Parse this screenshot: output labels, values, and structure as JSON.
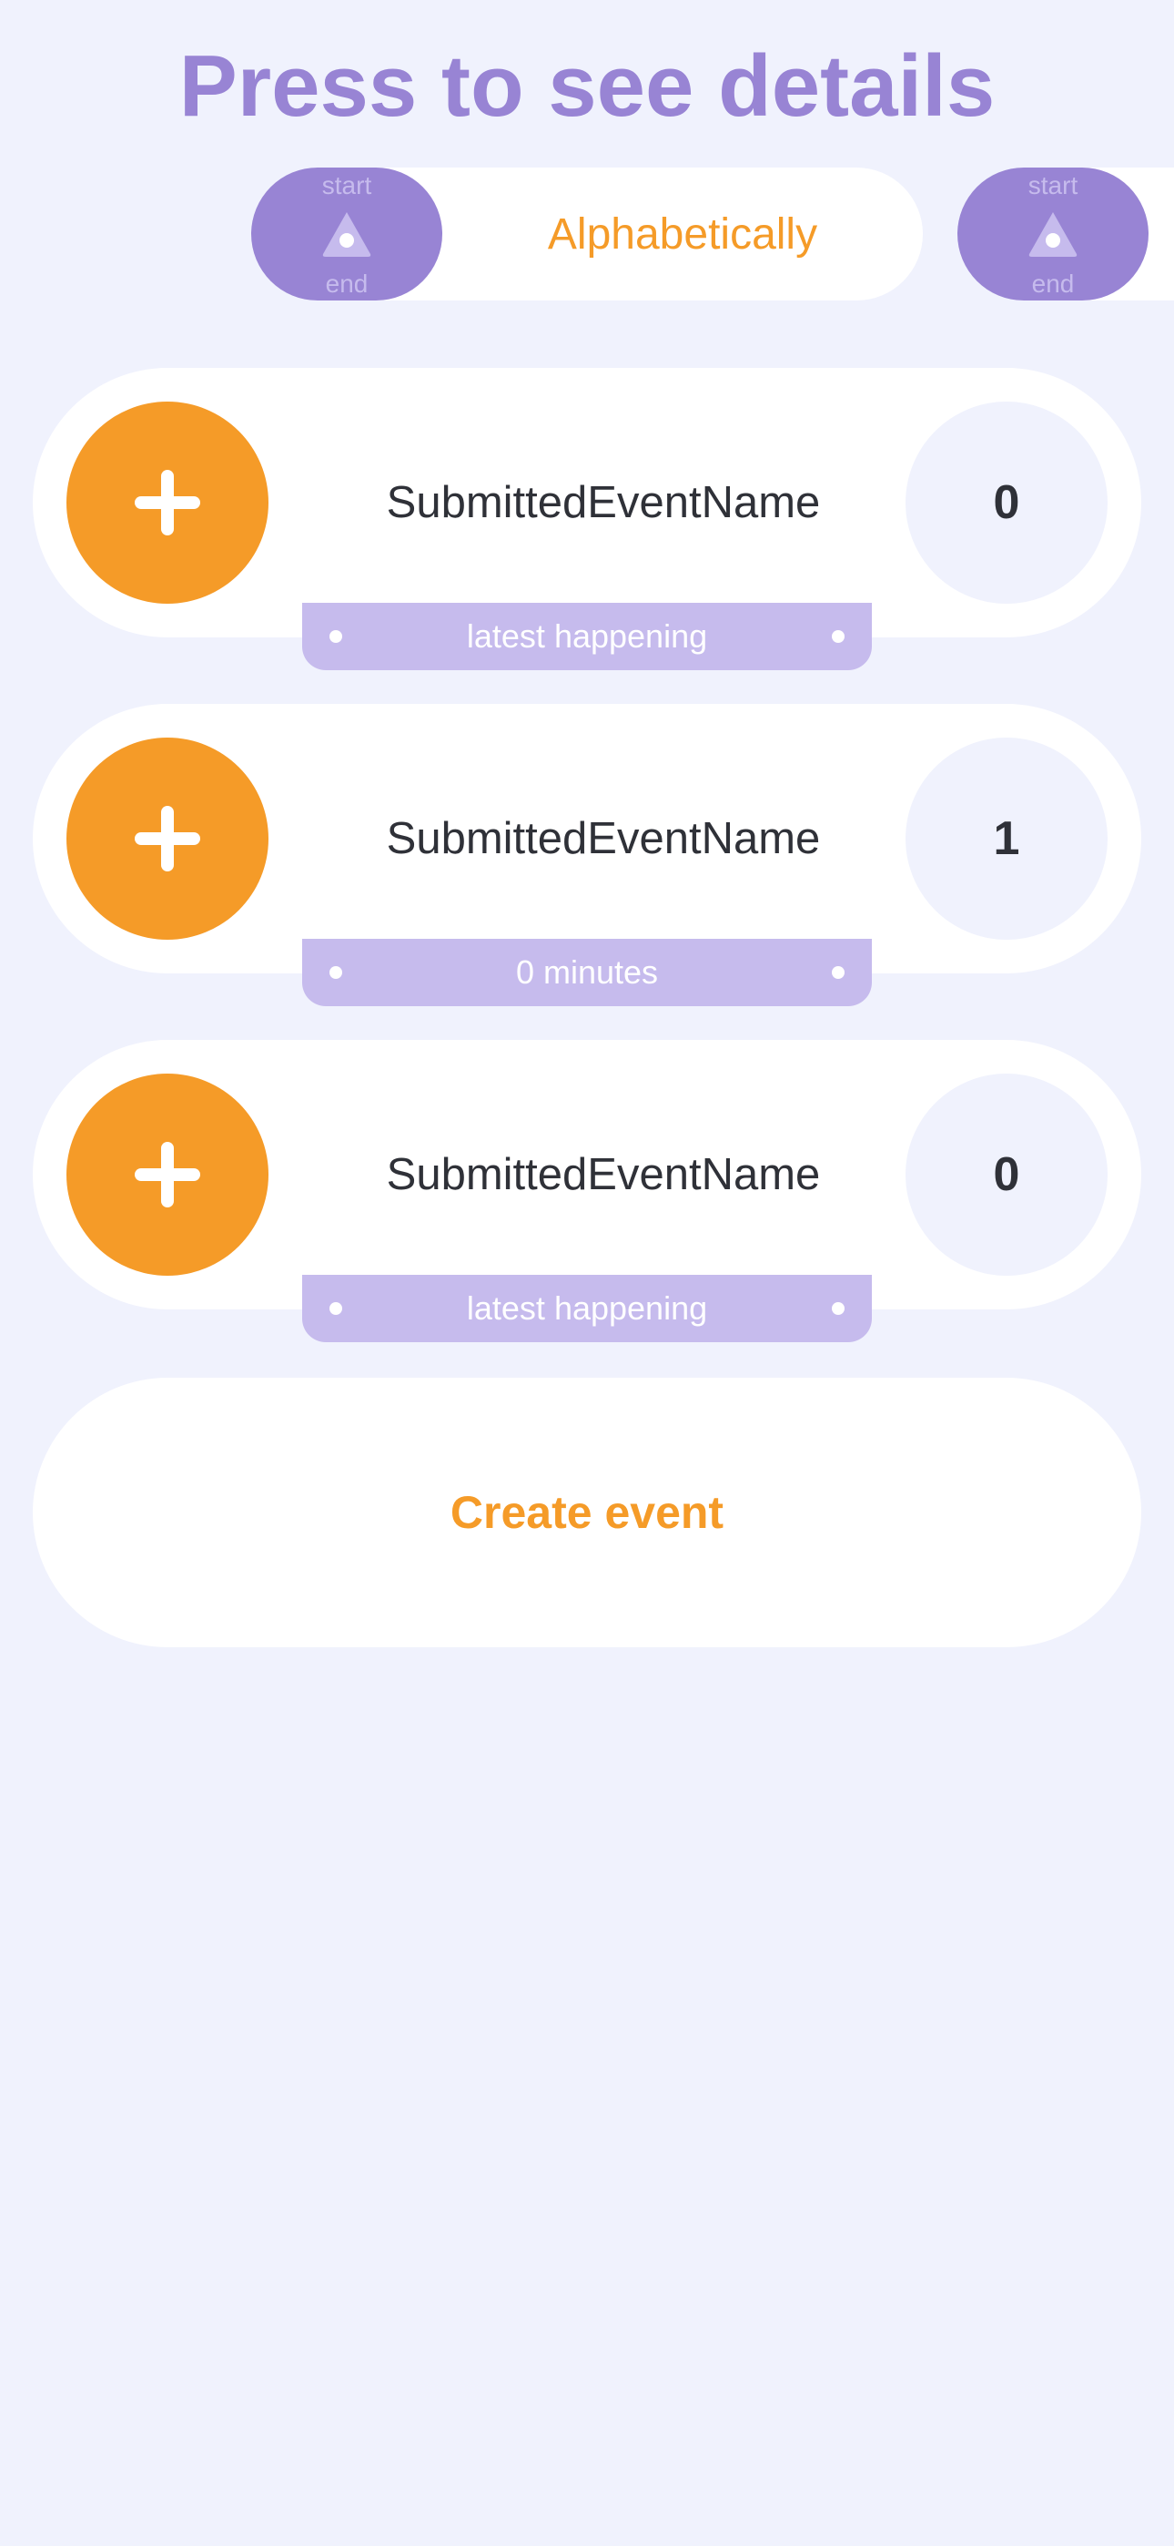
{
  "header": {
    "title": "Press to see details"
  },
  "sort": {
    "label": "Alphabetically",
    "direction_toggle": {
      "start_label": "start",
      "end_label": "end",
      "icon": "triangle-direction-icon"
    }
  },
  "events": [
    {
      "name": "SubmittedEventName",
      "count": "0",
      "latest": "latest happening"
    },
    {
      "name": "SubmittedEventName",
      "count": "1",
      "latest": "0 minutes"
    },
    {
      "name": "SubmittedEventName",
      "count": "0",
      "latest": "latest happening"
    }
  ],
  "actions": {
    "create_label": "Create event"
  },
  "colors": {
    "background": "#f0f2fd",
    "accent_purple": "#9884d4",
    "light_purple": "#c6bbed",
    "accent_orange": "#f59b28",
    "card": "#ffffff",
    "text_dark": "#2f3138"
  },
  "icons": {
    "add": "plus-icon"
  }
}
